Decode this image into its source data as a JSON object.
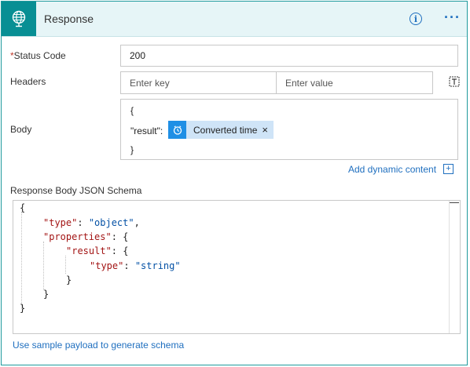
{
  "header": {
    "title": "Response",
    "action_icon": "globe-icon",
    "info_icon": "info-icon",
    "more_icon": "more-icon"
  },
  "status_code": {
    "label": "Status Code",
    "required_mark": "*",
    "value": "200"
  },
  "headers": {
    "label": "Headers",
    "key_placeholder": "Enter key",
    "value_placeholder": "Enter value",
    "mode_icon": "switch-to-text-mode-icon"
  },
  "body": {
    "label": "Body",
    "line_open": "{",
    "result_key": "\"result\":",
    "token_label": "Converted time",
    "token_icon": "clock-icon",
    "token_close": "×",
    "line_close": "}"
  },
  "add_dynamic_content": {
    "label": "Add dynamic content",
    "icon": "+"
  },
  "schema": {
    "label": "Response Body JSON Schema",
    "lines": {
      "l1": "{",
      "l2_key": "\"type\"",
      "l2_sep": ": ",
      "l2_val": "\"object\"",
      "l2_end": ",",
      "l3_key": "\"properties\"",
      "l3_end": ": {",
      "l4_key": "\"result\"",
      "l4_end": ": {",
      "l5_key": "\"type\"",
      "l5_sep": ": ",
      "l5_val": "\"string\"",
      "l6": "}",
      "l7": "}",
      "l8": "}"
    }
  },
  "use_sample_payload": {
    "label": "Use sample payload to generate schema"
  },
  "colors": {
    "accent": "#088f94",
    "header_bg": "#e6f5f7",
    "link": "#1f6fbf",
    "token_bg": "#cfe4f7",
    "token_icon_bg": "#1f8fe5",
    "required": "#c0392b"
  }
}
